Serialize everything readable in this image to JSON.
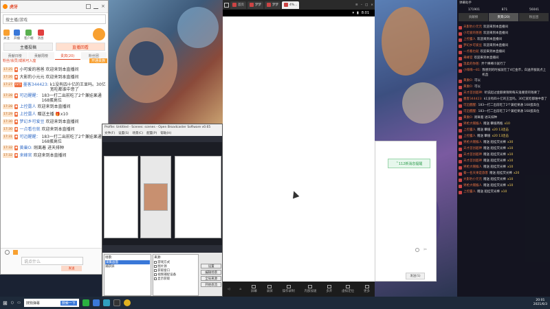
{
  "chat_window": {
    "toolbar_badge": "虎牙",
    "search_placeholder": "搜主播/游戏",
    "icons": [
      {
        "label": "关注"
      },
      {
        "label": "开播"
      },
      {
        "label": "客户端"
      },
      {
        "label": "消息"
      }
    ],
    "main_tabs": [
      {
        "label": "主播投稿"
      },
      {
        "label": "直播回看"
      }
    ],
    "sub_tabs": [
      {
        "label": "贡献日榜"
      },
      {
        "label": "贡献周榜"
      },
      {
        "label": "贵宾(20)"
      },
      {
        "label": "粉丝团"
      }
    ],
    "fans_tip": "粉丝/会员/成就可入座",
    "fans_btn": "开通贵族",
    "input_placeholder": "说点什么",
    "send_label": "发送",
    "messages": [
      {
        "time": "17:25",
        "badge": "",
        "name": "",
        "msg": "小可爱的爸爸  欢迎来到本直播间"
      },
      {
        "time": "17:26",
        "badge": "",
        "name": "",
        "msg": "大影豹小元元  欢迎来到本直播间"
      },
      {
        "time": "17:27",
        "badge": "LV.5",
        "name": "墨客344423:",
        "msg": "k1没有四十亿的王显吗。30亿宽吃都谁中意了"
      },
      {
        "time": "17:28",
        "badge": "",
        "name": "可迈醒醒：",
        "msg": "183一打二出前吃了2个兼娃果通 168蛋高位"
      },
      {
        "time": "17:28",
        "badge": "",
        "name": "上控露人",
        "msg": "欢迎来到本直播间"
      },
      {
        "time": "17:29",
        "badge": "",
        "name": "上控露人",
        "msg": "赠送主播 🎁x10"
      },
      {
        "time": "17:30",
        "badge": "",
        "name": "梦幻乡可爱豆",
        "msg": "欢迎来到本直播间"
      },
      {
        "time": "17:30",
        "badge": "",
        "name": "一点看也就",
        "msg": "欢迎来到本直播间"
      },
      {
        "time": "17:31",
        "badge": "",
        "name": "可迈醒醒：",
        "msg": "183一打二出前吃了2个兼娃果通 168蛋高位"
      },
      {
        "time": "17:32",
        "badge": "",
        "name": "黄巢O:",
        "msg": "刚离着 进天排种"
      },
      {
        "time": "17:32",
        "badge": "",
        "name": "来峰官",
        "msg": "欢迎来到本直播间"
      }
    ]
  },
  "obs": {
    "title": "Profile: Untitled - Scenes: scenes - Open Broadcaster Software v0.65",
    "menu": [
      "文件(F)",
      "设置(S)",
      "场景(C)",
      "配置(P)",
      "帮助(H)"
    ],
    "scenes_header": "场景:",
    "scenes": [
      "采集画面",
      "捕获屏"
    ],
    "sources_header": "来源:",
    "sources": [
      "游戏方式",
      "图片源",
      "获取窗口",
      "视频捕捉设备",
      "显示获取"
    ],
    "buttons": [
      "设置",
      "编辑场景",
      "全局来源",
      "开始串流"
    ]
  },
  "emulator": {
    "tabs": [
      {
        "label": "首页"
      },
      {
        "label": "梦梦"
      },
      {
        "label": "梦梦"
      },
      {
        "label": "4%..."
      }
    ],
    "status_time": "8:01",
    "toolbar": [
      {
        "label": "屏幕"
      },
      {
        "label": "录屏"
      },
      {
        "label": "操作录制"
      },
      {
        "label": "内部加速"
      },
      {
        "label": "多开"
      },
      {
        "label": "虚拟定位"
      },
      {
        "label": "更多"
      }
    ]
  },
  "qq_popup": {
    "notice": "112新消息提醒",
    "send_label": "发送(S)"
  },
  "danmu": {
    "header": "弹幕助手",
    "stats": [
      "171901",
      "871",
      "56041"
    ],
    "tabs": [
      {
        "label": "贡献榜"
      },
      {
        "label": "贵宾(20)"
      },
      {
        "label": "粉丝团"
      }
    ],
    "items": [
      {
        "name": "天影豹小元元",
        "msg": "欢迎来到本直播间",
        "gift": ""
      },
      {
        "name": "小可爱的爸爸",
        "msg": "欢迎来到本直播间",
        "gift": ""
      },
      {
        "name": "上控露人",
        "msg": "欢迎来到本直播间",
        "gift": ""
      },
      {
        "name": "梦幻乡可爱豆",
        "msg": "欢迎来到本直播间",
        "gift": ""
      },
      {
        "name": "一点看也就",
        "msg": "欢迎来到本直播间",
        "gift": ""
      },
      {
        "name": "来峰官",
        "msg": "欢迎来到本直播间",
        "gift": ""
      },
      {
        "name": "温柔的你爸:",
        "msg": "弄个棒棒冷就行了",
        "gift": ""
      },
      {
        "name": "小嗨嗨一81:",
        "msg": "我感到的时候就在了4亿金币，白送开服就点上机直",
        "gift": ""
      },
      {
        "name": "黄巢O:",
        "msg": "可以",
        "gift": ""
      },
      {
        "name": "黄巢O:",
        "msg": "可以",
        "gift": ""
      },
      {
        "name": "天才首创超神:",
        "msg": "听说起过金额要限制每天鬼撞受的钱要了",
        "gift": ""
      },
      {
        "name": "墨客344423:",
        "msg": "k1没有四十亿的王显吗。30亿宽吃都谁中意了",
        "gift": ""
      },
      {
        "name": "可迈醒醒:",
        "msg": "183一打二出前吃了2个兼娃果通 168蛋高位",
        "gift": ""
      },
      {
        "name": "可迈醒醒:",
        "msg": "183一打二出前吃了2个兼娃果通 168蛋高位",
        "gift": ""
      },
      {
        "name": "黄巢O:",
        "msg": "刚离着 进天排种",
        "gift": ""
      },
      {
        "name": "男枪大帽猴人",
        "msg": "赠送 攀援两瓶",
        "gift": "x10"
      },
      {
        "name": "上控露人",
        "msg": "赠送 攀援",
        "gift": "x20 13连击"
      },
      {
        "name": "上控露人",
        "msg": "赠送 攀援",
        "gift": "x20 13连击"
      },
      {
        "name": "男枪大帽猴人",
        "msg": "赠送 船挂荧光棒",
        "gift": "x30"
      },
      {
        "name": "天才首创超神",
        "msg": "赠送 船挂荧光棒",
        "gift": "x10"
      },
      {
        "name": "天才首创超神",
        "msg": "赠送 船挂荧光棒",
        "gift": "x10"
      },
      {
        "name": "天才首创超神",
        "msg": "赠送 船挂荧光棒",
        "gift": "x10"
      },
      {
        "name": "男枪大帽猴人",
        "msg": "赠送 船挂荧光棒",
        "gift": "x10"
      },
      {
        "name": "秦一名天果是旅客",
        "msg": "赠送 船挂荧光棒",
        "gift": "x20"
      },
      {
        "name": "大影豹小元元",
        "msg": "赠送 船挂荧光棒",
        "gift": "x10"
      },
      {
        "name": "男枪大帽猴人",
        "msg": "赠送 船挂荧光棒",
        "gift": "x10"
      },
      {
        "name": "上控露人",
        "msg": "赠送 船挂荧光棒",
        "gift": "x10"
      }
    ]
  },
  "taskbar": {
    "search_text": "搜狗弹幕",
    "search_btn": "搜索一下",
    "time": "20:01",
    "date": "2021/6/3"
  }
}
